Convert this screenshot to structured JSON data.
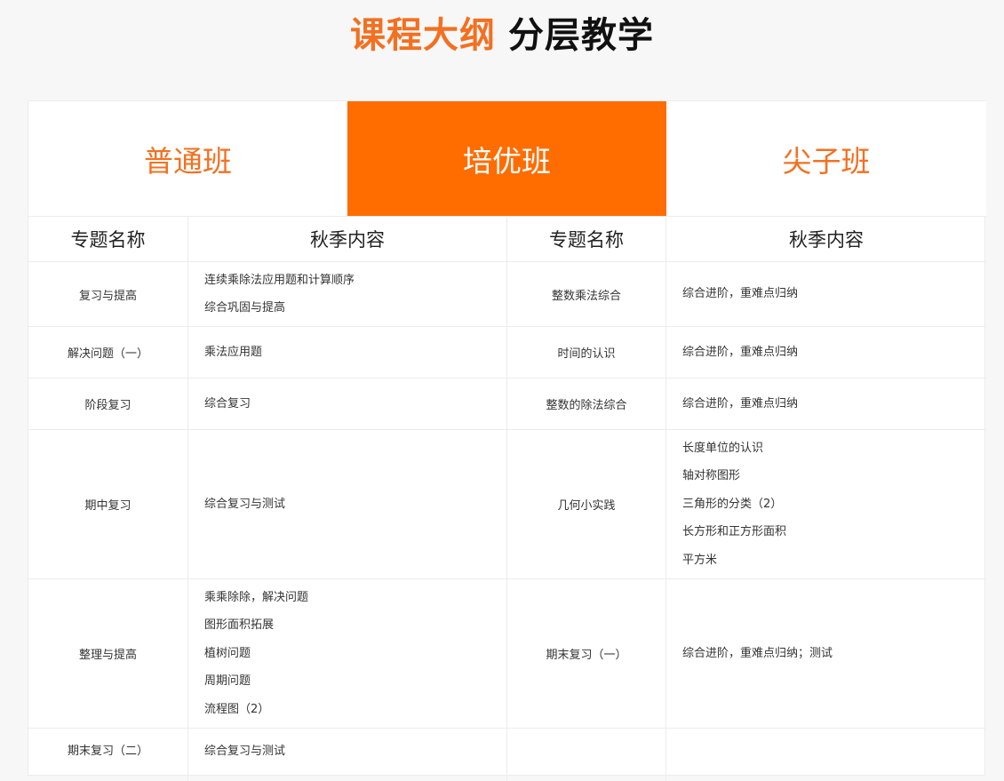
{
  "title": {
    "accent": "课程大纲",
    "rest": "分层教学"
  },
  "tabs": [
    {
      "label": "普通班",
      "active": false
    },
    {
      "label": "培优班",
      "active": true
    },
    {
      "label": "尖子班",
      "active": false
    }
  ],
  "header": [
    "专题名称",
    "秋季内容",
    "专题名称",
    "秋季内容"
  ],
  "rows": [
    {
      "left_topic": "复习与提高",
      "left_content": [
        "连续乘除法应用题和计算顺序",
        "综合巩固与提高"
      ],
      "right_topic": "整数乘法综合",
      "right_content": [
        "综合进阶，重难点归纳"
      ]
    },
    {
      "left_topic": "解决问题（一）",
      "left_content": [
        "乘法应用题"
      ],
      "right_topic": "时间的认识",
      "right_content": [
        "综合进阶，重难点归纳"
      ]
    },
    {
      "left_topic": "阶段复习",
      "left_content": [
        "综合复习"
      ],
      "right_topic": "整数的除法综合",
      "right_content": [
        "综合进阶，重难点归纳"
      ]
    },
    {
      "left_topic": "期中复习",
      "left_content": [
        "综合复习与测试"
      ],
      "right_topic": "几何小实践",
      "right_content": [
        "长度单位的认识",
        "轴对称图形",
        "三角形的分类（2）",
        "长方形和正方形面积",
        "平方米"
      ]
    },
    {
      "left_topic": "整理与提高",
      "left_content": [
        "乘乘除除，解决问题",
        "图形面积拓展",
        "植树问题",
        "周期问题",
        "流程图（2）"
      ],
      "right_topic": "期末复习（一）",
      "right_content": [
        "综合进阶，重难点归纳；测试"
      ]
    },
    {
      "left_topic": "期末复习（二）",
      "left_content": [
        "综合复习与测试"
      ],
      "right_topic": "",
      "right_content": []
    }
  ]
}
